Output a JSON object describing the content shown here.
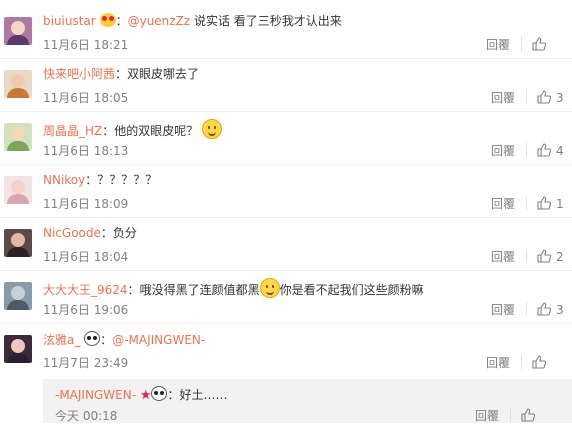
{
  "reply_label": "回覆",
  "like_icon": "thumbs-up-icon",
  "accent_color": "#eb7350",
  "comments": [
    {
      "user": "biuiustar",
      "user_badge": "heart-eyes-emoji",
      "separator": "：",
      "mention": "@yuenzZz",
      "text": "说实话 看了三秒我才认出来",
      "time": "11月6日 18:21",
      "likes": "",
      "avatar_bg": "#b07aa0",
      "avatar_head": "#f3d6c8",
      "avatar_body": "#5b3b6a"
    },
    {
      "user": "快来吧小阿茜",
      "separator": "：",
      "text": "双眼皮哪去了",
      "time": "11月6日 18:05",
      "likes": "3",
      "avatar_bg": "#e8d9c6",
      "avatar_head": "#f0c9b0",
      "avatar_body": "#c9783a"
    },
    {
      "user": "周晶晶_HZ",
      "separator": "：",
      "text": "他的双眼皮呢？",
      "emoji": "smile-emoji",
      "time": "11月6日 18:13",
      "likes": "4",
      "avatar_bg": "#cfe3c0",
      "avatar_head": "#f5d8b8",
      "avatar_body": "#7fa45a"
    },
    {
      "user": "NNikoy",
      "separator": "：",
      "text": "？？？？？",
      "time": "11月6日 18:09",
      "likes": "1",
      "avatar_bg": "#f2e4e4",
      "avatar_head": "#f3d3c6",
      "avatar_body": "#d9a7b0"
    },
    {
      "user": "NicGoode",
      "separator": "：",
      "text": "负分",
      "time": "11月6日 18:04",
      "likes": "2",
      "avatar_bg": "#5a4a4a",
      "avatar_head": "#e2b8a0",
      "avatar_body": "#2b2222"
    },
    {
      "user": "大大大王_9624",
      "separator": "：",
      "text": "哦没得黑了连颜值都黑",
      "emoji": "smile-emoji",
      "text2": "你是看不起我们这些颜粉嘛",
      "time": "11月6日 19:06",
      "likes": "3",
      "avatar_bg": "#8a9aa8",
      "avatar_head": "#c7d0d8",
      "avatar_body": "#4c5a66"
    },
    {
      "user": "泫雅a_",
      "user_badge": "panda-emoji",
      "separator": "：",
      "mention": "@-MAJINGWEN-",
      "text": "",
      "time": "11月7日 23:49",
      "likes": "",
      "avatar_bg": "#3a2a3a",
      "avatar_head": "#f1c7c0",
      "avatar_body": "#2a2030"
    }
  ],
  "sub_reply": {
    "user": "-MAJINGWEN-",
    "user_badge_1": "star",
    "user_badge_2": "panda-emoji",
    "separator": "：",
    "text": "好土……",
    "time": "今天 00:18",
    "likes": ""
  }
}
